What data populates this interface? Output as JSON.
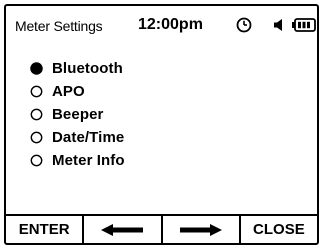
{
  "header": {
    "title": "Meter Settings",
    "time": "12:00pm",
    "icons": [
      "clock-icon",
      "speaker-icon",
      "battery-icon"
    ]
  },
  "menu": {
    "items": [
      {
        "label": "Bluetooth",
        "selected": true
      },
      {
        "label": "APO",
        "selected": false
      },
      {
        "label": "Beeper",
        "selected": false
      },
      {
        "label": "Date/Time",
        "selected": false
      },
      {
        "label": "Meter Info",
        "selected": false
      }
    ]
  },
  "softkeys": {
    "enter": "ENTER",
    "left": "left-arrow-icon",
    "right": "right-arrow-icon",
    "close": "CLOSE"
  },
  "colors": {
    "foreground": "#000000",
    "background": "#ffffff"
  }
}
